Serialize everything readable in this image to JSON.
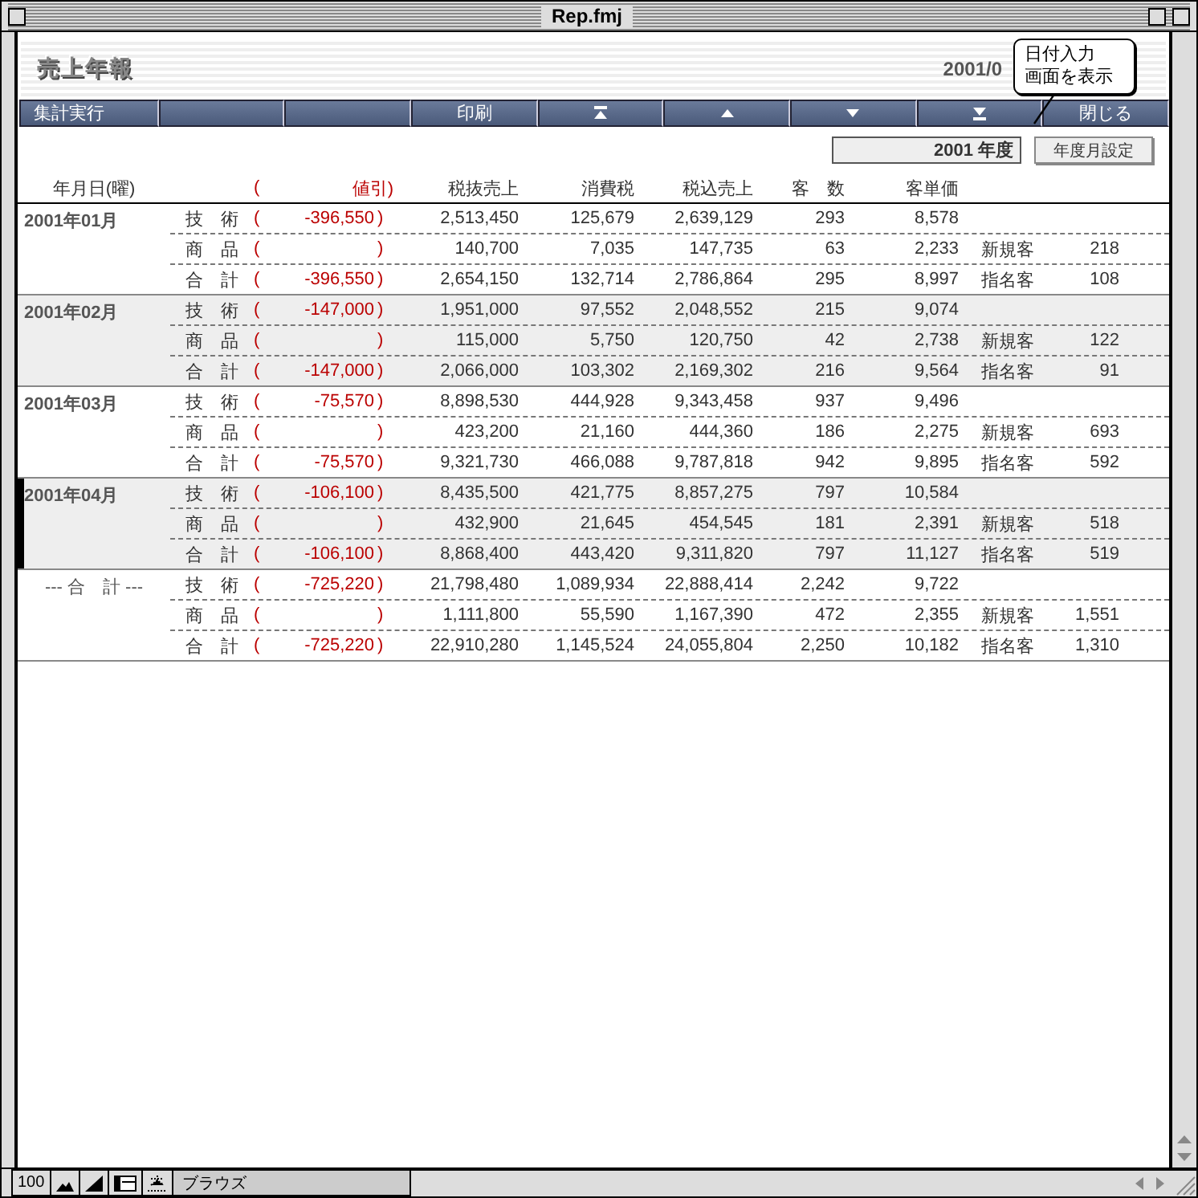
{
  "window": {
    "title": "Rep.fmj"
  },
  "report_title": "売上年報",
  "date_text": "2001/0",
  "tooltip": {
    "lines": [
      "日付入力",
      "画面を表示"
    ]
  },
  "toolbar": [
    {
      "kind": "text",
      "label": "集計実行"
    },
    {
      "kind": "blank"
    },
    {
      "kind": "blank"
    },
    {
      "kind": "text",
      "label": "印刷"
    },
    {
      "kind": "first"
    },
    {
      "kind": "prev"
    },
    {
      "kind": "next"
    },
    {
      "kind": "last"
    },
    {
      "kind": "text",
      "label": "閉じる"
    }
  ],
  "year_field": {
    "value": "2001 年度"
  },
  "year_button": "年度月設定",
  "headers": {
    "date": "年月日(曜)",
    "open": "(",
    "discount": "値引)",
    "pretax": "税抜売上",
    "tax": "消費税",
    "total": "税込売上",
    "customers": "客　数",
    "unit_price": "客単価"
  },
  "groups": [
    {
      "label": "2001年01月",
      "selected": false,
      "rows": [
        {
          "category": "技　術",
          "open": "(",
          "discount": "-396,550",
          "close": ")",
          "pretax": "2,513,450",
          "tax": "125,679",
          "total": "2,639,129",
          "customers": "293",
          "unit_price": "8,578"
        },
        {
          "category": "商　品",
          "open": "(",
          "close": ")",
          "pretax": "140,700",
          "tax": "7,035",
          "total": "147,735",
          "customers": "63",
          "unit_price": "2,233",
          "type": "新規客",
          "type_count": "218"
        },
        {
          "category": "合　計",
          "open": "(",
          "discount": "-396,550",
          "close": ")",
          "pretax": "2,654,150",
          "tax": "132,714",
          "total": "2,786,864",
          "customers": "295",
          "unit_price": "8,997",
          "type": "指名客",
          "type_count": "108"
        }
      ]
    },
    {
      "label": "2001年02月",
      "selected": false,
      "rows": [
        {
          "category": "技　術",
          "open": "(",
          "discount": "-147,000",
          "close": ")",
          "pretax": "1,951,000",
          "tax": "97,552",
          "total": "2,048,552",
          "customers": "215",
          "unit_price": "9,074"
        },
        {
          "category": "商　品",
          "open": "(",
          "close": ")",
          "pretax": "115,000",
          "tax": "5,750",
          "total": "120,750",
          "customers": "42",
          "unit_price": "2,738",
          "type": "新規客",
          "type_count": "122"
        },
        {
          "category": "合　計",
          "open": "(",
          "discount": "-147,000",
          "close": ")",
          "pretax": "2,066,000",
          "tax": "103,302",
          "total": "2,169,302",
          "customers": "216",
          "unit_price": "9,564",
          "type": "指名客",
          "type_count": "91"
        }
      ]
    },
    {
      "label": "2001年03月",
      "selected": false,
      "rows": [
        {
          "category": "技　術",
          "open": "(",
          "discount": "-75,570",
          "close": ")",
          "pretax": "8,898,530",
          "tax": "444,928",
          "total": "9,343,458",
          "customers": "937",
          "unit_price": "9,496"
        },
        {
          "category": "商　品",
          "open": "(",
          "close": ")",
          "pretax": "423,200",
          "tax": "21,160",
          "total": "444,360",
          "customers": "186",
          "unit_price": "2,275",
          "type": "新規客",
          "type_count": "693"
        },
        {
          "category": "合　計",
          "open": "(",
          "discount": "-75,570",
          "close": ")",
          "pretax": "9,321,730",
          "tax": "466,088",
          "total": "9,787,818",
          "customers": "942",
          "unit_price": "9,895",
          "type": "指名客",
          "type_count": "592"
        }
      ]
    },
    {
      "label": "2001年04月",
      "selected": true,
      "rows": [
        {
          "category": "技　術",
          "open": "(",
          "discount": "-106,100",
          "close": ")",
          "pretax": "8,435,500",
          "tax": "421,775",
          "total": "8,857,275",
          "customers": "797",
          "unit_price": "10,584"
        },
        {
          "category": "商　品",
          "open": "(",
          "close": ")",
          "pretax": "432,900",
          "tax": "21,645",
          "total": "454,545",
          "customers": "181",
          "unit_price": "2,391",
          "type": "新規客",
          "type_count": "518"
        },
        {
          "category": "合　計",
          "open": "(",
          "discount": "-106,100",
          "close": ")",
          "pretax": "8,868,400",
          "tax": "443,420",
          "total": "9,311,820",
          "customers": "797",
          "unit_price": "11,127",
          "type": "指名客",
          "type_count": "519"
        }
      ]
    },
    {
      "label": "--- 合　計 ---",
      "selected": false,
      "rows": [
        {
          "category": "技　術",
          "open": "(",
          "discount": "-725,220",
          "close": ")",
          "pretax": "21,798,480",
          "tax": "1,089,934",
          "total": "22,888,414",
          "customers": "2,242",
          "unit_price": "9,722"
        },
        {
          "category": "商　品",
          "open": "(",
          "close": ")",
          "pretax": "1,111,800",
          "tax": "55,590",
          "total": "1,167,390",
          "customers": "472",
          "unit_price": "2,355",
          "type": "新規客",
          "type_count": "1,551"
        },
        {
          "category": "合　計",
          "open": "(",
          "discount": "-725,220",
          "close": ")",
          "pretax": "22,910,280",
          "tax": "1,145,524",
          "total": "24,055,804",
          "customers": "2,250",
          "unit_price": "10,182",
          "type": "指名客",
          "type_count": "1,310"
        }
      ]
    }
  ],
  "status_bar": {
    "zoom": "100",
    "mode": "ブラウズ"
  }
}
